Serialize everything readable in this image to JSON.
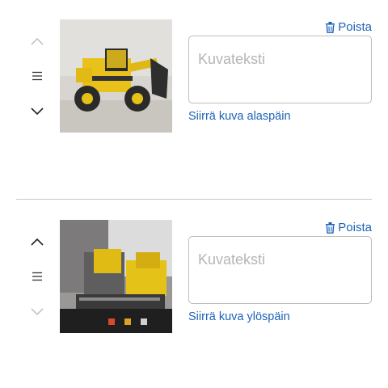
{
  "colors": {
    "link": "#1d62b7",
    "control_active": "#222222",
    "control_disabled": "#c4c4c4",
    "divider": "#c8c8c8",
    "border": "#bdbdbd"
  },
  "images": [
    {
      "delete_label": "Poista",
      "caption_value": "",
      "caption_placeholder": "Kuvateksti",
      "move_label": "Siirrä kuva alaspäin",
      "move_up_enabled": false,
      "move_down_enabled": true
    },
    {
      "delete_label": "Poista",
      "caption_value": "",
      "caption_placeholder": "Kuvateksti",
      "move_label": "Siirrä kuva ylöspäin",
      "move_up_enabled": true,
      "move_down_enabled": false
    }
  ],
  "icons": {
    "up": "chevron-up-icon",
    "drag": "drag-handle-icon",
    "down": "chevron-down-icon",
    "delete": "trash-icon"
  }
}
